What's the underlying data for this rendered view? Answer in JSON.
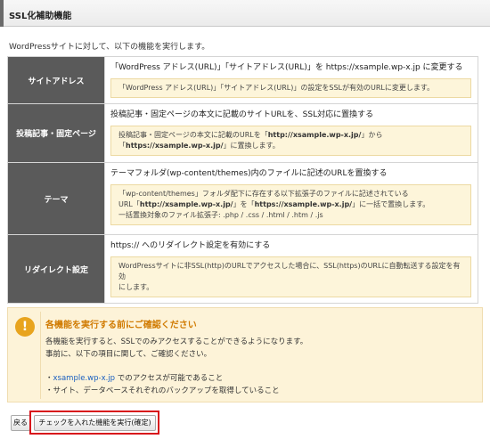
{
  "header": {
    "title": "SSL化補助機能"
  },
  "intro": "WordPressサイトに対して、以下の機能を実行します。",
  "options": [
    {
      "label": "サイトアドレス",
      "description": "「WordPress アドレス(URL)」「サイトアドレス(URL)」を https://xsample.wp-x.jp に変更する",
      "note_parts": [
        "「WordPress アドレス(URL)」「サイトアドレス(URL)」の設定をSSLが有効のURLに変更します。"
      ]
    },
    {
      "label": "投稿記事・固定ページ",
      "description": "投稿記事・固定ページの本文に記載のサイトURLを、SSL対応に置換する",
      "note_a": "投稿記事・固定ページの本文に記載のURLを「",
      "note_b": "http://xsample.wp-x.jp/",
      "note_c": "」から「",
      "note_d": "https://xsample.wp-x.jp/",
      "note_e": "」に置換します。"
    },
    {
      "label": "テーマ",
      "description": "テーマフォルダ(wp-content/themes)内のファイルに記述のURLを置換する",
      "note_l1": "「wp-content/themes」フォルダ配下に存在する以下拡張子のファイルに記述されている",
      "note_a": "URL「",
      "note_b": "http://xsample.wp-x.jp/",
      "note_c": "」を「",
      "note_d": "https://xsample.wp-x.jp/",
      "note_e": "」に一括で置換します。",
      "note_l3": "一括置換対象のファイル拡張子: .php / .css / .html / .htm / .js"
    },
    {
      "label": "リダイレクト設定",
      "description": "https:// へのリダイレクト設定を有効にする",
      "note_l1": "WordPressサイトに非SSL(http)のURLでアクセスした場合に、SSL(https)のURLに自動転送する設定を有効",
      "note_l2": "にします。"
    }
  ],
  "warning": {
    "icon": "!",
    "title": "各機能を実行する前にご確認ください",
    "p1": "各機能を実行すると、SSLでのみアクセスすることができるようになります。",
    "p2": "事前に、以下の項目に関して、ご確認ください。",
    "bullet1_prefix": "・",
    "bullet1_link": "xsample.wp-x.jp",
    "bullet1_suffix": " でのアクセスが可能であること",
    "bullet2": "・サイト、データベースそれぞれのバックアップを取得していること"
  },
  "buttons": {
    "back": "戻る",
    "execute": "チェックを入れた機能を実行(確定)"
  },
  "colors": {
    "label_bg": "#5a5a5a",
    "note_bg": "#fdf5da",
    "warn_title": "#d07a00",
    "link": "#1a5fc0",
    "focus": "#d8121b"
  }
}
